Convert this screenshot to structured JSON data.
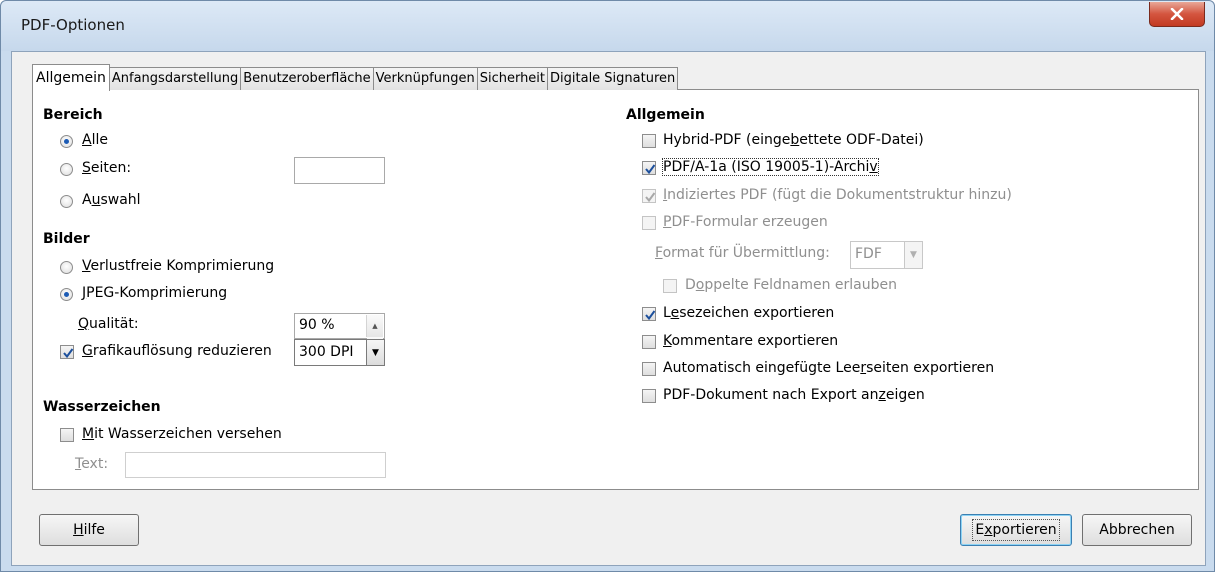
{
  "window": {
    "title": "PDF-Optionen"
  },
  "tabs": [
    "Allgemein",
    "Anfangsdarstellung",
    "Benutzeroberfläche",
    "Verknüpfungen",
    "Sicherheit",
    "Digitale Signaturen"
  ],
  "bereich": {
    "heading": "Bereich",
    "alle": {
      "pre": "",
      "key": "A",
      "post": "lle"
    },
    "seiten": {
      "pre": "",
      "key": "S",
      "post": "eiten:"
    },
    "auswahl": {
      "pre": "A",
      "key": "u",
      "post": "swahl"
    }
  },
  "bilder": {
    "heading": "Bilder",
    "verlustfrei": {
      "pre": "",
      "key": "V",
      "post": "erlustfreie Komprimierung"
    },
    "jpeg": {
      "pre": "",
      "key": "J",
      "post": "PEG-Komprimierung"
    },
    "qualitaet": {
      "pre": "",
      "key": "Q",
      "post": "ualität:"
    },
    "qualitaet_value": "90 %",
    "grafik": {
      "pre": "",
      "key": "G",
      "post": "rafikauflösung reduzieren"
    },
    "dpi_value": "300 DPI"
  },
  "wasserzeichen": {
    "heading": "Wasserzeichen",
    "mit": {
      "pre": "",
      "key": "M",
      "post": "it Wasserzeichen versehen"
    },
    "text": {
      "pre": "",
      "key": "T",
      "post": "ext:"
    }
  },
  "allgemein": {
    "heading": "Allgemein",
    "hybrid": {
      "pre": "Hybrid-PDF (einge",
      "key": "b",
      "post": "ettete ODF-Datei)"
    },
    "pdfa": {
      "pre": "PDF/A-1a (ISO 19005-1)-Archi",
      "key": "v",
      "post": ""
    },
    "indiziert": {
      "pre": "",
      "key": "I",
      "post": "ndiziertes PDF (fügt die Dokumentstruktur hinzu)"
    },
    "formular": {
      "pre": "",
      "key": "P",
      "post": "DF-Formular erzeugen"
    },
    "format": {
      "pre": "",
      "key": "F",
      "post": "ormat für Übermittlung:"
    },
    "format_value": "FDF",
    "doppelte": {
      "pre": "D",
      "key": "o",
      "post": "ppelte Feldnamen erlauben"
    },
    "lesezeichen": {
      "pre": "L",
      "key": "e",
      "post": "sezeichen exportieren"
    },
    "kommentare": {
      "pre": "",
      "key": "K",
      "post": "ommentare exportieren"
    },
    "leerseiten": {
      "pre": "Automatisch eingefügte Lee",
      "key": "r",
      "post": "seiten exportieren"
    },
    "anzeigen": {
      "pre": "PDF-Dokument nach Export an",
      "key": "z",
      "post": "eigen"
    }
  },
  "buttons": {
    "hilfe": {
      "pre": "",
      "key": "H",
      "post": "ilfe"
    },
    "exportieren": {
      "pre": "E",
      "key": "x",
      "post": "portieren"
    },
    "abbrechen": "Abbrechen"
  },
  "colors": {
    "accent": "#1c5bb4",
    "close": "#c9463a",
    "frame": "#c9dbee"
  }
}
